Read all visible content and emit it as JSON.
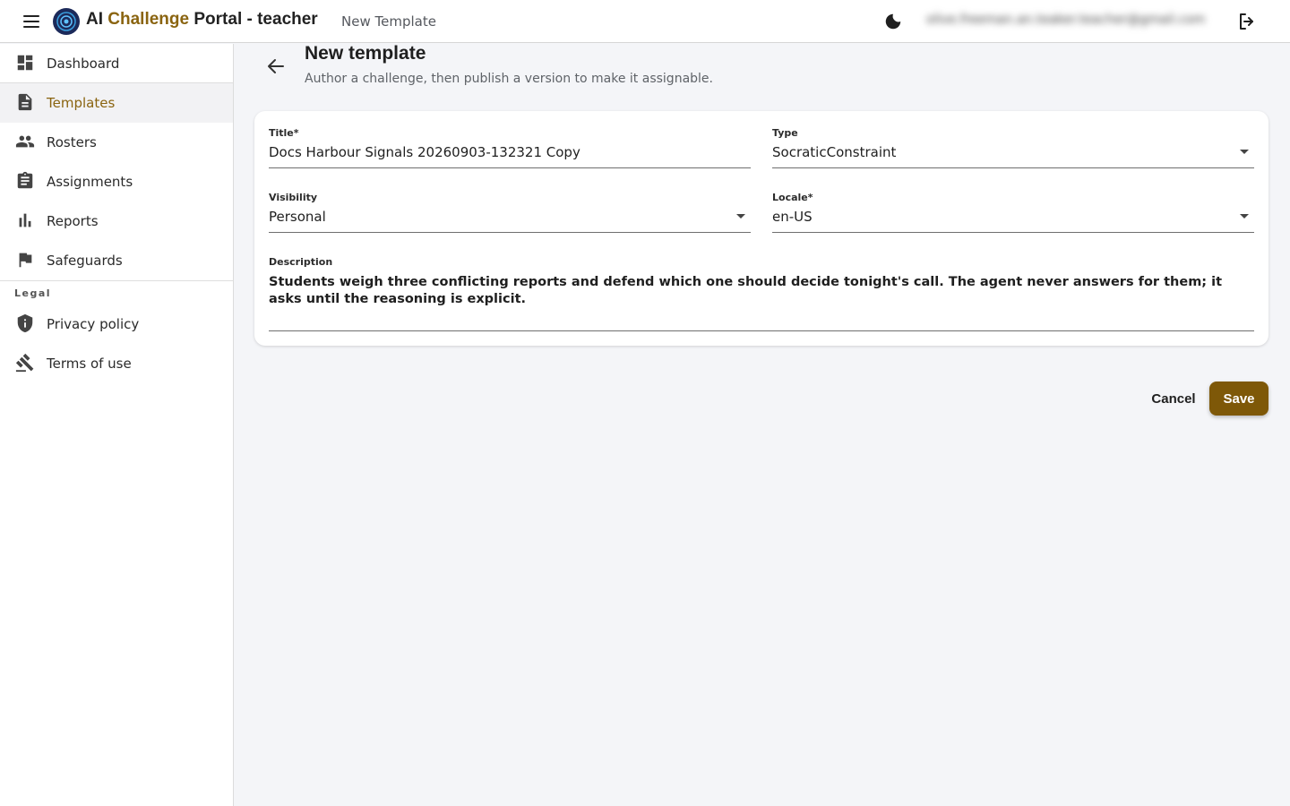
{
  "header": {
    "brand_part1": "AI ",
    "brand_accent": "Challenge",
    "brand_part2": " Portal - teacher",
    "breadcrumb": "New Template",
    "user_email": "olive.freeman.an.teaker.teacher@gmail.com",
    "icons": [
      "menu-icon",
      "app-logo",
      "dark-mode-moon-icon",
      "logout-icon"
    ]
  },
  "sidebar": {
    "items": [
      {
        "label": "Dashboard",
        "icon": "dashboard-icon"
      },
      {
        "label": "Templates",
        "icon": "document-icon",
        "active": true
      },
      {
        "label": "Rosters",
        "icon": "people-icon"
      },
      {
        "label": "Assignments",
        "icon": "clipboard-icon"
      },
      {
        "label": "Reports",
        "icon": "bar-chart-icon"
      },
      {
        "label": "Safeguards",
        "icon": "flag-icon"
      }
    ],
    "legal_heading": "Legal",
    "legal_items": [
      {
        "label": "Privacy policy",
        "icon": "shield-icon"
      },
      {
        "label": "Terms of use",
        "icon": "gavel-icon"
      }
    ]
  },
  "main": {
    "title": "New template",
    "subtitle": "Author a challenge, then publish a version to make it assignable.",
    "form": {
      "title_label": "Title*",
      "title_value": "Docs Harbour Signals 20260903-132321 Copy",
      "type_label": "Type",
      "type_value": "SocraticConstraint",
      "visibility_label": "Visibility",
      "visibility_value": "Personal",
      "locale_label": "Locale*",
      "locale_value": "en-US",
      "description_label": "Description",
      "description_value": "Students weigh three conflicting reports and defend which one should decide tonight's call. The agent never answers for them; it asks until the reasoning is explicit."
    },
    "actions": {
      "cancel": "Cancel",
      "save": "Save"
    }
  },
  "colors": {
    "accent": "#8a6410",
    "save_bg": "#7e5808",
    "page_bg": "#f4f5f8"
  }
}
